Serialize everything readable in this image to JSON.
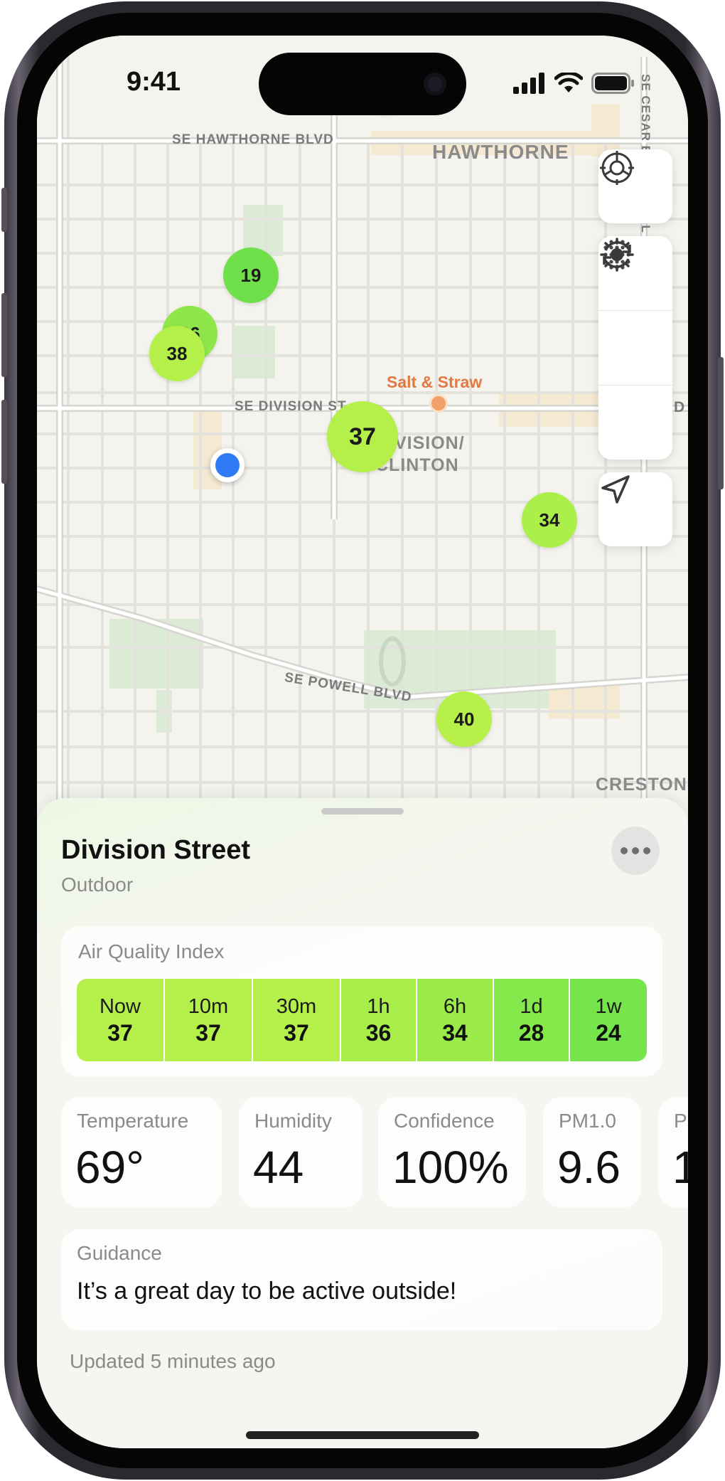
{
  "status_bar": {
    "time": "9:41"
  },
  "map": {
    "streets": {
      "hawthorne": "SE HAWTHORNE BLVD",
      "division": "SE DIVISION ST",
      "powell": "SE POWELL BLVD",
      "cesar": "SE CESAR E CHAVEZ BL",
      "division_partial": "D"
    },
    "districts": {
      "hawthorne": "HAWTHORNE",
      "division_clinton": "DIVISION/\nCLINTON",
      "creston": "CRESTON-"
    },
    "poi": {
      "name": "Salt & Straw"
    },
    "sensors": [
      {
        "value": "37",
        "color": "#b5f04a"
      },
      {
        "value": "19",
        "color": "#6fe04a"
      },
      {
        "value": "36",
        "color": "#8fe64a"
      },
      {
        "value": "38",
        "color": "#b5f04a"
      },
      {
        "value": "37",
        "color": "#b5f04a"
      },
      {
        "value": "34",
        "color": "#aaef4a"
      },
      {
        "value": "40",
        "color": "#b8f04a"
      }
    ],
    "controls": [
      "sensor-settings-icon",
      "density-dots-icon",
      "brightness-icon",
      "history-icon",
      "location-arrow-icon"
    ]
  },
  "sheet": {
    "title": "Division Street",
    "subtitle": "Outdoor",
    "aqi": {
      "label": "Air Quality Index",
      "periods": [
        {
          "period": "Now",
          "value": "37",
          "color": "#b5f04a"
        },
        {
          "period": "10m",
          "value": "37",
          "color": "#b5f04a"
        },
        {
          "period": "30m",
          "value": "37",
          "color": "#b5f04a"
        },
        {
          "period": "1h",
          "value": "36",
          "color": "#a8ee4b"
        },
        {
          "period": "6h",
          "value": "34",
          "color": "#9bec4b"
        },
        {
          "period": "1d",
          "value": "28",
          "color": "#85e84b"
        },
        {
          "period": "1w",
          "value": "24",
          "color": "#76e44b"
        }
      ]
    },
    "metrics": [
      {
        "label": "Temperature",
        "value": "69°"
      },
      {
        "label": "Humidity",
        "value": "44"
      },
      {
        "label": "Confidence",
        "value": "100%"
      },
      {
        "label": "PM1.0",
        "value": "9.6"
      },
      {
        "label": "P",
        "value": "1"
      }
    ],
    "guidance": {
      "label": "Guidance",
      "text": "It’s a great day to be active outside!"
    },
    "updated": "Updated 5 minutes ago"
  }
}
